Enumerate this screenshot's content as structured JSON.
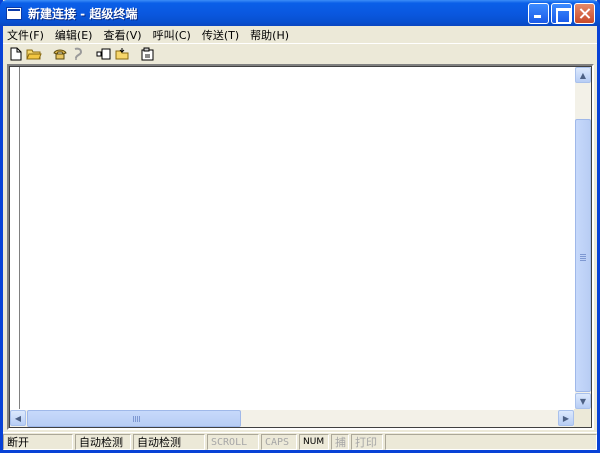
{
  "window": {
    "title": "新建连接 - 超级终端"
  },
  "menubar": {
    "items": [
      {
        "id": "file",
        "label": "文件(F)"
      },
      {
        "id": "edit",
        "label": "编辑(E)"
      },
      {
        "id": "view",
        "label": "查看(V)"
      },
      {
        "id": "call",
        "label": "呼叫(C)"
      },
      {
        "id": "transfer",
        "label": "传送(T)"
      },
      {
        "id": "help",
        "label": "帮助(H)"
      }
    ]
  },
  "toolbar": {
    "buttons": [
      {
        "id": "new",
        "icon": "new-document-icon"
      },
      {
        "id": "open",
        "icon": "open-folder-icon"
      },
      {
        "id": "connect",
        "icon": "phone-icon"
      },
      {
        "id": "disconnect",
        "icon": "hangup-icon"
      },
      {
        "id": "send",
        "icon": "send-file-icon"
      },
      {
        "id": "receive",
        "icon": "receive-file-icon"
      },
      {
        "id": "properties",
        "icon": "properties-icon"
      }
    ]
  },
  "statusbar": {
    "connection": "断开",
    "detect1": "自动检测",
    "detect2": "自动检测",
    "scroll": "SCROLL",
    "caps": "CAPS",
    "num": "NUM",
    "capture": "捕",
    "print": "打印"
  },
  "colors": {
    "titlebar": "#0a58e0",
    "chrome": "#ece9d8",
    "scroll_thumb": "#c1d3fb"
  }
}
